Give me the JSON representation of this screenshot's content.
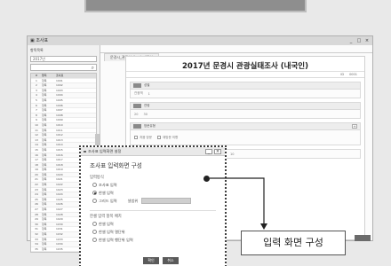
{
  "window": {
    "title": "▣ 조사표",
    "controls": [
      "_",
      "□",
      "×"
    ]
  },
  "sidebar": {
    "title": "항목목록",
    "filter_text": "2017년",
    "table_headers": [
      "#",
      "항목",
      "조사표"
    ],
    "rows": [
      [
        "1",
        "항목",
        "1001"
      ],
      [
        "2",
        "항목",
        "1002"
      ],
      [
        "3",
        "항목",
        "1003"
      ],
      [
        "4",
        "항목",
        "1004"
      ],
      [
        "5",
        "항목",
        "1005"
      ],
      [
        "6",
        "항목",
        "1006"
      ],
      [
        "7",
        "항목",
        "1007"
      ],
      [
        "8",
        "항목",
        "1008"
      ],
      [
        "9",
        "항목",
        "1009"
      ],
      [
        "10",
        "항목",
        "1010"
      ],
      [
        "11",
        "항목",
        "1011"
      ],
      [
        "12",
        "항목",
        "1012"
      ],
      [
        "13",
        "항목",
        "1013"
      ],
      [
        "14",
        "항목",
        "1014"
      ],
      [
        "15",
        "항목",
        "1015"
      ],
      [
        "16",
        "항목",
        "1016"
      ],
      [
        "17",
        "항목",
        "1017"
      ],
      [
        "18",
        "항목",
        "1018"
      ],
      [
        "19",
        "항목",
        "1019"
      ],
      [
        "20",
        "항목",
        "1020"
      ],
      [
        "21",
        "항목",
        "1021"
      ],
      [
        "22",
        "항목",
        "1022"
      ],
      [
        "23",
        "항목",
        "1023"
      ],
      [
        "24",
        "항목",
        "1024"
      ],
      [
        "25",
        "항목",
        "1025"
      ],
      [
        "26",
        "항목",
        "1026"
      ],
      [
        "27",
        "항목",
        "1027"
      ],
      [
        "28",
        "항목",
        "1028"
      ],
      [
        "29",
        "항목",
        "1029"
      ],
      [
        "30",
        "항목",
        "1030"
      ],
      [
        "31",
        "항목",
        "1031"
      ],
      [
        "32",
        "항목",
        "1032"
      ],
      [
        "33",
        "항목",
        "1033"
      ],
      [
        "34",
        "항목",
        "1034"
      ],
      [
        "35",
        "항목",
        "1035"
      ]
    ]
  },
  "tabs": [
    "문경시_관광실태조사_내국인"
  ],
  "form": {
    "title": "2017년 문경시 관광실태조사 (내국인)",
    "meta": [
      "ID",
      "0001"
    ],
    "sections": [
      {
        "label": "성별",
        "body": [
          "관광객",
          "1"
        ]
      },
      {
        "label": "연령",
        "body": [
          "20",
          "30"
        ]
      },
      {
        "label": "방문유형",
        "body": [
          "처음 방문",
          "재방문 의향"
        ]
      }
    ],
    "lower_field": "10"
  },
  "dialog": {
    "title": "조사표 입력화면 설정",
    "heading": "조사표 입력화면 구성",
    "group1_label": "입력방식",
    "group1": [
      "조사표 입력",
      "한셀 입력",
      "그리드 입력"
    ],
    "cell_label": "셀범위",
    "group2_label": "한셀 입력 항목 배치",
    "group2": [
      "한셀 입력",
      "한셀 입력 열단위",
      "한셀 입력 행단위 입력"
    ],
    "ok": "확인",
    "cancel": "취소"
  },
  "callout": {
    "text": "입력 화면 구성"
  }
}
